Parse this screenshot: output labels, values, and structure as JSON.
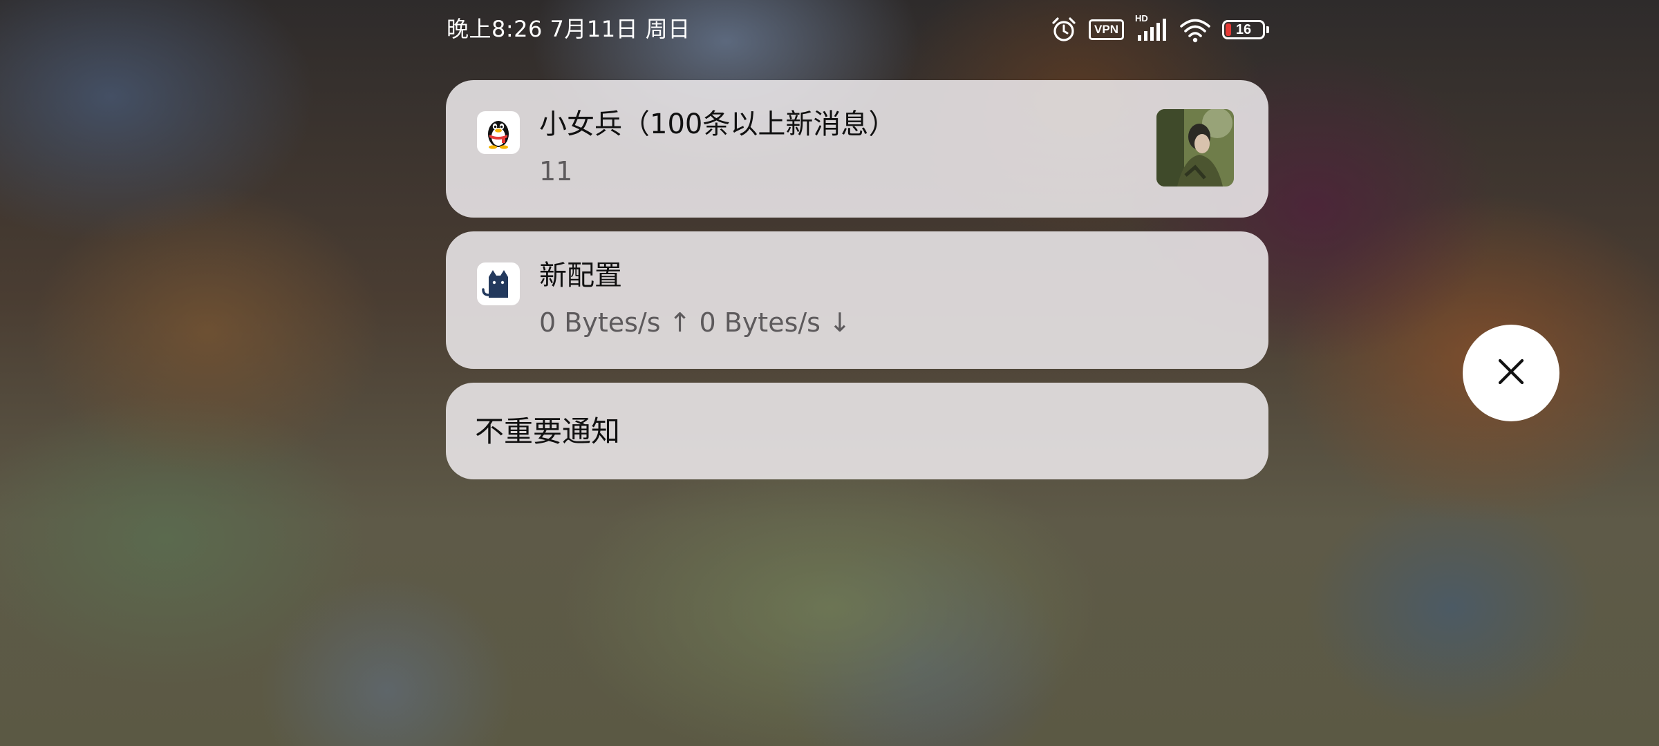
{
  "status_bar": {
    "time_date": "晚上8:26 7月11日 周日",
    "alarm_icon": "alarm-clock-icon",
    "vpn_label": "VPN",
    "hd_label": "HD",
    "signal_icon": "cellular-signal-icon",
    "wifi_icon": "wifi-icon",
    "battery_level": "16",
    "battery_fraction": 0.16,
    "battery_fill_color": "#e53935"
  },
  "notifications": [
    {
      "app_icon": "qq-penguin-icon",
      "title": "小女兵（100条以上新消息）",
      "text": "11",
      "has_thumbnail": true
    },
    {
      "app_icon": "clash-cat-icon",
      "title": "新配置",
      "text": "0 Bytes/s ↑ 0 Bytes/s ↓"
    }
  ],
  "unimportant": {
    "label": "不重要通知"
  },
  "close_button": {
    "icon": "close-icon"
  },
  "colors": {
    "card_background": "#ece8ea",
    "title_text": "#111111",
    "secondary_text": "#5d5a5c",
    "status_text": "#ffffff"
  }
}
